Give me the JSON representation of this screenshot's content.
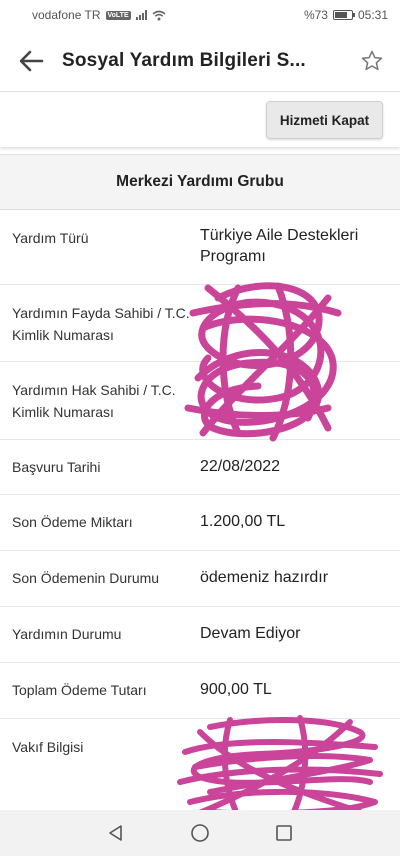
{
  "status_bar": {
    "carrier": "vodafone TR",
    "volte": "VoLTE",
    "battery": "%73",
    "time": "05:31",
    "battery_level": 0.73
  },
  "app_bar": {
    "title": "Sosyal Yardım Bilgileri S...",
    "back_icon": "arrow-left-icon",
    "favorite_icon": "star-outline-icon"
  },
  "actions": {
    "close_service_label": "Hizmeti Kapat"
  },
  "panel": {
    "heading": "Merkezi Yardımı Grubu",
    "rows": [
      {
        "label": "Yardım Türü",
        "value": "Türkiye Aile Destekleri Programı"
      },
      {
        "label": "Yardımın Fayda Sahibi / T.C. Kimlik Numarası",
        "value": ""
      },
      {
        "label": "Yardımın Hak Sahibi / T.C. Kimlik Numarası",
        "value": ""
      },
      {
        "label": "Başvuru Tarihi",
        "value": "22/08/2022"
      },
      {
        "label": "Son Ödeme Miktarı",
        "value": "1.200,00 TL"
      },
      {
        "label": "Son Ödemenin Durumu",
        "value": "ödemeniz hazırdır"
      },
      {
        "label": "Yardımın Durumu",
        "value": "Devam Ediyor"
      },
      {
        "label": "Toplam Ödeme Tutarı",
        "value": "900,00 TL"
      },
      {
        "label": "Vakıf Bilgisi",
        "value": ""
      }
    ]
  },
  "redaction_color": "#c83b94",
  "nav_bar": {
    "back_icon": "nav-back-triangle-icon",
    "home_icon": "nav-home-circle-icon",
    "recents_icon": "nav-recents-square-icon"
  }
}
